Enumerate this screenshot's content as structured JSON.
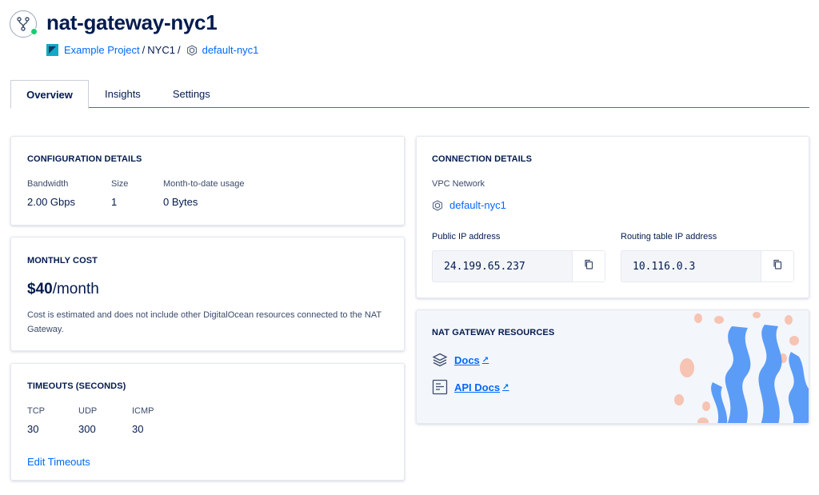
{
  "header": {
    "title": "nat-gateway-nyc1",
    "breadcrumb": {
      "project": "Example Project",
      "sep1": "/",
      "region": "NYC1",
      "sep2": "/",
      "vpc": "default-nyc1"
    }
  },
  "tabs": [
    {
      "label": "Overview",
      "active": true
    },
    {
      "label": "Insights",
      "active": false
    },
    {
      "label": "Settings",
      "active": false
    }
  ],
  "configuration": {
    "title": "CONFIGURATION DETAILS",
    "bandwidth_label": "Bandwidth",
    "bandwidth_value": "2.00 Gbps",
    "size_label": "Size",
    "size_value": "1",
    "usage_label": "Month-to-date usage",
    "usage_value": "0 Bytes"
  },
  "monthly_cost": {
    "title": "MONTHLY COST",
    "amount": "$40",
    "period": "/month",
    "note": "Cost is estimated and does not include other DigitalOcean resources connected to the NAT Gateway."
  },
  "timeouts": {
    "title": "TIMEOUTS (SECONDS)",
    "tcp_label": "TCP",
    "tcp_value": "30",
    "udp_label": "UDP",
    "udp_value": "300",
    "icmp_label": "ICMP",
    "icmp_value": "30",
    "edit_link": "Edit Timeouts"
  },
  "connection": {
    "title": "CONNECTION DETAILS",
    "vpc_label": "VPC Network",
    "vpc_link": "default-nyc1",
    "public_ip_label": "Public IP address",
    "public_ip": "24.199.65.237",
    "routing_ip_label": "Routing table IP address",
    "routing_ip": "10.116.0.3"
  },
  "resources": {
    "title": "NAT GATEWAY RESOURCES",
    "docs_label": "Docs",
    "api_docs_label": "API Docs",
    "ext_arrow": "↗"
  },
  "icons": {
    "header": "nat-gateway-icon",
    "copy": "copy-icon",
    "vpc": "vpc-network-icon",
    "docs": "layers-icon",
    "api_docs": "document-icon",
    "external": "external-link-icon"
  },
  "colors": {
    "primary": "#0069ff",
    "text": "#031b4e",
    "status": "#15cd72",
    "illustration_blue": "#5b9cf7",
    "illustration_peach": "#f7c3b2"
  }
}
